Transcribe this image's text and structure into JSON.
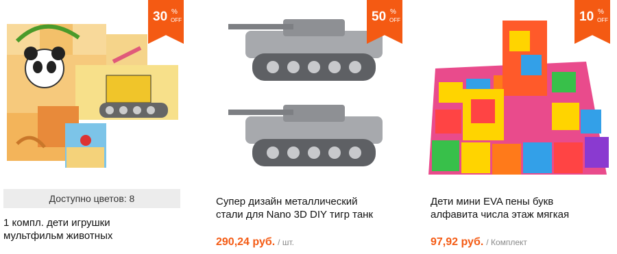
{
  "products": [
    {
      "discount": "30",
      "pct": "%",
      "off": "OFF",
      "colors_available": "Доступно цветов: 8",
      "title_line1": "1 компл. дети игрушки",
      "title_line2": "мультфильм животных",
      "image_icon": "wooden-puzzle-cubes-image"
    },
    {
      "discount": "50",
      "pct": "%",
      "off": "OFF",
      "title_line1": "Супер дизайн металлический",
      "title_line2": "стали для Nano 3D DIY тигр танк",
      "price": "290,24 руб.",
      "unit": "/ шт.",
      "image_icon": "metal-tank-model-image"
    },
    {
      "discount": "10",
      "pct": "%",
      "off": "OFF",
      "title_line1": "Дети мини EVA пены букв",
      "title_line2": "алфавита числа этаж мягкая",
      "price": "97,92 руб.",
      "unit": "/ Комплект",
      "image_icon": "foam-alphabet-mat-image"
    }
  ],
  "colors": {
    "accent": "#f45a13",
    "muted": "#888888",
    "panel": "#ececec"
  }
}
